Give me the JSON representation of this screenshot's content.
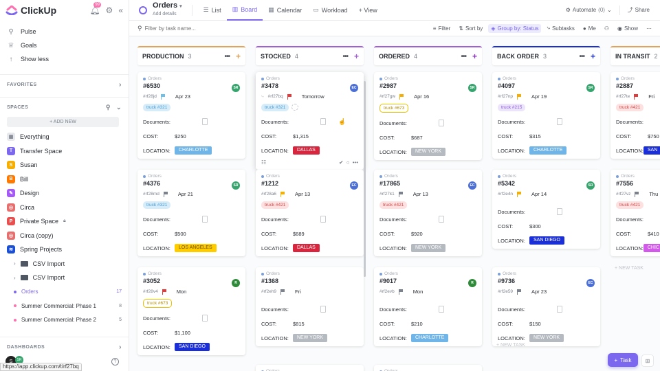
{
  "sidebar": {
    "logo": "ClickUp",
    "notifications": "99",
    "nav": [
      {
        "label": "Pulse",
        "icon": "pulse-icon",
        "glyph": "⚲"
      },
      {
        "label": "Goals",
        "icon": "trophy-icon",
        "glyph": "♕"
      },
      {
        "label": "Show less",
        "icon": "arrow-up-icon",
        "glyph": "↑"
      }
    ],
    "favorites_label": "FAVORITES",
    "spaces_label": "SPACES",
    "add_new": "+ ADD NEW",
    "spaces": [
      {
        "label": "Everything",
        "letter": "",
        "color": "#9aa0a8"
      },
      {
        "label": "Transfer Space",
        "letter": "T",
        "color": "#7b68ee"
      },
      {
        "label": "Susan",
        "letter": "S",
        "color": "#f8ae00"
      },
      {
        "label": "Bill",
        "letter": "B",
        "color": "#ff7800"
      },
      {
        "label": "Design",
        "letter": "",
        "color": "#a55af7"
      },
      {
        "label": "Circa",
        "letter": "",
        "color": "#e86e6e"
      },
      {
        "label": "Private Space",
        "letter": "P",
        "color": "#e84f4f"
      },
      {
        "label": "Circa (copy)",
        "letter": "",
        "color": "#e86e6e"
      },
      {
        "label": "Spring Projects",
        "letter": "",
        "color": "#1b4fd8"
      }
    ],
    "folders": [
      {
        "label": "CSV Import"
      },
      {
        "label": "CSV Import"
      }
    ],
    "lists": [
      {
        "label": "Orders",
        "count": "17",
        "color": "#7b68ee"
      },
      {
        "label": "Summer Commercial: Phase 1",
        "count": "8",
        "color": "#fd71af"
      },
      {
        "label": "Summer Commercial: Phase 2",
        "count": "5",
        "color": "#fd71af"
      }
    ],
    "dashboards_label": "DASHBOARDS",
    "status_url": "https://app.clickup.com/t/rf27bq"
  },
  "header": {
    "title": "Orders",
    "subtitle": "Add details",
    "tabs": [
      {
        "label": "List",
        "icon": "list-icon",
        "glyph": "☰"
      },
      {
        "label": "Board",
        "icon": "board-icon",
        "glyph": "▥"
      },
      {
        "label": "Calendar",
        "icon": "calendar-icon",
        "glyph": "▦"
      },
      {
        "label": "Workload",
        "icon": "workload-icon",
        "glyph": "▭"
      },
      {
        "label": "+ View",
        "icon": "",
        "glyph": ""
      }
    ],
    "automate": "Automate",
    "automate_count": "(0)",
    "share": "Share"
  },
  "toolbar": {
    "search_placeholder": "Filter by task name...",
    "filter": "Filter",
    "sort": "Sort by",
    "group": "Group by: Status",
    "subtasks": "Subtasks",
    "me": "Me",
    "show": "Show"
  },
  "labels": {
    "list_name": "Orders",
    "documents": "Documents:",
    "cost": "COST:",
    "location": "LOCATION:",
    "new_task": "+ NEW TASK"
  },
  "columns": [
    {
      "name": "PRODUCTION",
      "count": "3",
      "color": "#e2a25b",
      "plus_color": "#e2a25b",
      "cards": [
        {
          "id": "#6530",
          "code": "#rf28jd",
          "date": "Apr 23",
          "flag": "#6fbfe6",
          "tag": "truck #321",
          "tag_bg": "#d6ecf9",
          "tag_fg": "#4a9ad1",
          "cost": "$250",
          "loc": "CHARLOTTE",
          "loc_bg": "#6fb5e8",
          "avatar": "SR",
          "av_color": "#36a46d"
        },
        {
          "id": "#4376",
          "code": "#rf28md",
          "date": "Apr 21",
          "flag": "#7c828d",
          "tag": "truck #321",
          "tag_bg": "#d6ecf9",
          "tag_fg": "#4a9ad1",
          "cost": "$500",
          "loc": "LOS ANGELES",
          "loc_bg": "#ffcc00",
          "loc_fg": "#6b4d00",
          "avatar": "SR",
          "av_color": "#36a46d"
        },
        {
          "id": "#3052",
          "code": "#rf28v4",
          "date": "Mon",
          "flag": "#e03c3c",
          "tag": "truck #673",
          "tag_bg": "#fff",
          "tag_fg": "#b58d00",
          "tag_border": "#e8c200",
          "cost": "$1,100",
          "loc": "SAN DIEGO",
          "loc_bg": "#1b2fd8",
          "avatar": "R",
          "av_color": "#2f8a3a"
        }
      ]
    },
    {
      "name": "STOCKED",
      "count": "4",
      "color": "#a25ed8",
      "plus_color": "#a25ed8",
      "cards": [
        {
          "id": "#3478",
          "code": "#rf27bq",
          "date": "Tomorrow",
          "flag": "#e03c3c",
          "tag": "truck #321",
          "tag_bg": "#d6ecf9",
          "tag_fg": "#4a9ad1",
          "cost": "$1,315",
          "loc": "DALLAS",
          "loc_bg": "#d7263d",
          "avatar": "EC",
          "av_color": "#4b6fd6"
        },
        {
          "id": "#1212",
          "code": "#rf28a6",
          "date": "Apr 13",
          "flag": "#f8ae00",
          "tag": "truck #421",
          "tag_bg": "#fde0e0",
          "tag_fg": "#d04848",
          "cost": "$689",
          "loc": "DALLAS",
          "loc_bg": "#d7263d",
          "avatar": "EC",
          "av_color": "#4b6fd6"
        },
        {
          "id": "#1368",
          "code": "#rf2eh9",
          "date": "Fri",
          "flag": "#7c828d",
          "tag": "",
          "cost": "$815",
          "loc": "NEW YORK",
          "loc_bg": "#b5b9c0",
          "avatar": "",
          "av_color": ""
        }
      ]
    },
    {
      "name": "ORDERED",
      "count": "4",
      "color": "#a25ed8",
      "plus_color": "#8e35c8",
      "cards": [
        {
          "id": "#2987",
          "code": "#rf27gw",
          "date": "Apr 16",
          "flag": "#f8ae00",
          "tag": "truck #673",
          "tag_bg": "#fff",
          "tag_fg": "#b58d00",
          "tag_border": "#e8c200",
          "cost": "$687",
          "loc": "NEW YORK",
          "loc_bg": "#b5b9c0",
          "avatar": "SR",
          "av_color": "#36a46d"
        },
        {
          "id": "#17865",
          "code": "#rf27k1",
          "date": "Apr 13",
          "flag": "#7c828d",
          "tag": "truck #421",
          "tag_bg": "#fde0e0",
          "tag_fg": "#d04848",
          "cost": "$920",
          "loc": "NEW YORK",
          "loc_bg": "#b5b9c0",
          "avatar": "EC",
          "av_color": "#4b6fd6"
        },
        {
          "id": "#9017",
          "code": "#rf2evb",
          "date": "Mon",
          "flag": "#7c828d",
          "tag": "",
          "cost": "$210",
          "loc": "CHARLOTTE",
          "loc_bg": "#6fb5e8",
          "avatar": "R",
          "av_color": "#2f8a3a"
        }
      ]
    },
    {
      "name": "BACK ORDER",
      "count": "3",
      "color": "#1b2fd8",
      "plus_color": "#1b2fd8",
      "cards": [
        {
          "id": "#4097",
          "code": "#rf27np",
          "date": "Apr 19",
          "flag": "#f8ae00",
          "tag": "truck #215",
          "tag_bg": "#ece4fb",
          "tag_fg": "#8a5ad8",
          "cost": "$315",
          "loc": "CHARLOTTE",
          "loc_bg": "#6fb5e8",
          "avatar": "SR",
          "av_color": "#36a46d"
        },
        {
          "id": "#5342",
          "code": "#rf2e4n",
          "date": "Apr 14",
          "flag": "#f8ae00",
          "tag": "",
          "cost": "$300",
          "loc": "SAN DIEGO",
          "loc_bg": "#1b2fd8",
          "avatar": "SR",
          "av_color": "#36a46d"
        },
        {
          "id": "#9736",
          "code": "#rf2e59",
          "date": "Apr 23",
          "flag": "#7c828d",
          "tag": "",
          "cost": "$150",
          "loc": "NEW YORK",
          "loc_bg": "#b5b9c0",
          "avatar": "EC",
          "av_color": "#4b6fd6"
        }
      ]
    },
    {
      "name": "IN TRANSIT",
      "count": "2",
      "color": "#e2a25b",
      "plus_color": "#e2a25b",
      "cards": [
        {
          "id": "#2887",
          "code": "#rf27te",
          "date": "Fri",
          "flag": "#e03c3c",
          "tag": "truck #421",
          "tag_bg": "#fde0e0",
          "tag_fg": "#d04848",
          "cost": "$750",
          "loc": "SAN",
          "loc_bg": "#1b2fd8",
          "avatar": "",
          "av_color": ""
        },
        {
          "id": "#7556",
          "code": "#rf27vz",
          "date": "Thu",
          "flag": "#7c828d",
          "tag": "truck #421",
          "tag_bg": "#fde0e0",
          "tag_fg": "#d04848",
          "cost": "$410",
          "loc": "CHIC",
          "loc_bg": "#d15ae8",
          "avatar": "",
          "av_color": ""
        }
      ]
    }
  ],
  "bottom": {
    "task_button": "Task",
    "user_initial": "S",
    "user_badge": "SR"
  }
}
